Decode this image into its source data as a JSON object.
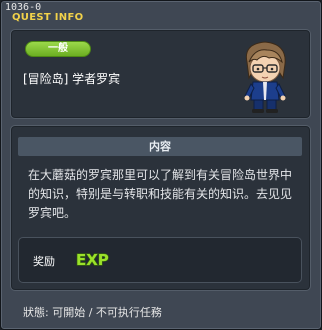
{
  "window": {
    "quest_id": "1036-0",
    "title": "QUEST INFO"
  },
  "header": {
    "category": "一般",
    "quest_name": "[冒险岛] 学者罗宾",
    "npc_icon": "npc-scholar-portrait"
  },
  "content": {
    "section_title": "内容",
    "description": "在大蘑菇的罗宾那里可以了解到有关冒险岛世界中的知识，特别是与转职和技能有关的知识。去见见罗宾吧。"
  },
  "reward": {
    "label": "奖励",
    "icon": "exp-icon",
    "icon_text": "EXP"
  },
  "status": {
    "text": "狀態: 可開始 / 不可执行任務"
  },
  "colors": {
    "title_yellow": "#f2d24a",
    "badge_green": "#7fc22e",
    "panel_bg": "#2b323b",
    "window_bg": "#3f4753"
  }
}
